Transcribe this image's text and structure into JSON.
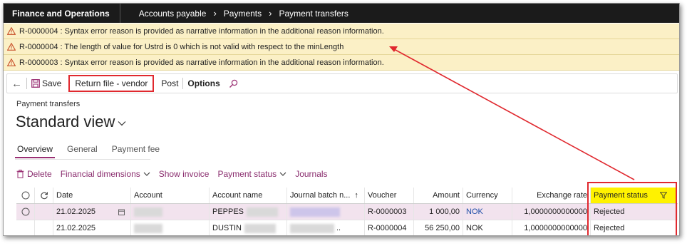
{
  "topbar": {
    "app": "Finance and Operations",
    "crumbs": [
      "Accounts payable",
      "Payments",
      "Payment transfers"
    ]
  },
  "warnings": [
    "R-0000004 : Syntax error reason is provided as narrative information in the additional reason information.",
    "R-0000004 : The length of value for Ustrd is 0 which is not valid with respect to the minLength",
    "R-0000003 : Syntax error reason is provided as narrative information in the additional reason information."
  ],
  "actionbar": {
    "save": "Save",
    "return_file": "Return file - vendor",
    "post": "Post",
    "options": "Options"
  },
  "page": {
    "subtitle": "Payment transfers",
    "view": "Standard view"
  },
  "tabs": [
    "Overview",
    "General",
    "Payment fee"
  ],
  "toolbar": {
    "delete": "Delete",
    "financial_dimensions": "Financial dimensions",
    "show_invoice": "Show invoice",
    "payment_status": "Payment status",
    "journals": "Journals"
  },
  "columns": {
    "date": "Date",
    "account": "Account",
    "account_name": "Account name",
    "journal_batch": "Journal batch n...",
    "voucher": "Voucher",
    "amount": "Amount",
    "currency": "Currency",
    "exchange_rate": "Exchange rate",
    "payment_status": "Payment status"
  },
  "rows": [
    {
      "date": "21.02.2025",
      "account_name": "PEPPES",
      "voucher": "R-0000003",
      "amount": "1 000,00",
      "currency": "NOK",
      "exchange_rate": "1,0000000000000",
      "payment_status": "Rejected"
    },
    {
      "date": "21.02.2025",
      "account_name": "DUSTIN",
      "journal_suffix": "..",
      "voucher": "R-0000004",
      "amount": "56 250,00",
      "currency": "NOK",
      "exchange_rate": "1,0000000000000",
      "payment_status": "Rejected"
    }
  ],
  "colors": {
    "accent": "#9a2f73",
    "annotation": "#e0282e",
    "warning_bg": "#fbf0c6",
    "highlight": "#fff200"
  }
}
